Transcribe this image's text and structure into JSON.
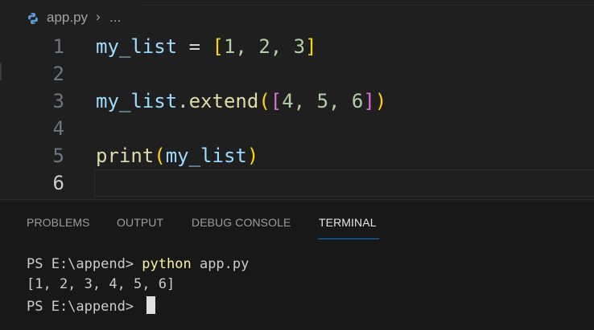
{
  "breadcrumb": {
    "file": "app.py",
    "separator": "›",
    "ellipsis": "..."
  },
  "editor": {
    "lines": [
      {
        "number": "1"
      },
      {
        "number": "2"
      },
      {
        "number": "3"
      },
      {
        "number": "4"
      },
      {
        "number": "5"
      },
      {
        "number": "6"
      }
    ],
    "code": {
      "line1": {
        "var": "my_list",
        "eq": " = ",
        "open": "[",
        "items": "1, 2, 3",
        "close": "]"
      },
      "line3": {
        "var": "my_list",
        "dot": ".",
        "fn": "extend",
        "open_paren": "(",
        "open_br": "[",
        "items": "4, 5, 6",
        "close_br": "]",
        "close_paren": ")"
      },
      "line5": {
        "fn": "print",
        "open_paren": "(",
        "var": "my_list",
        "close_paren": ")"
      }
    }
  },
  "panel": {
    "tabs": [
      "PROBLEMS",
      "OUTPUT",
      "DEBUG CONSOLE",
      "TERMINAL"
    ],
    "active_tab": "TERMINAL"
  },
  "terminal": {
    "prompt1": "PS E:\\append> ",
    "command": "python",
    "args": " app.py",
    "output": "[1, 2, 3, 4, 5, 6]",
    "prompt2": "PS E:\\append> "
  },
  "colors": {
    "background": "#1f1f1f",
    "variable": "#9cdcfe",
    "function": "#dcdcaa",
    "number": "#b5cea8",
    "bracket_level1": "#ffd700",
    "bracket_level2": "#da70d6",
    "terminal_command": "#f9f1a5",
    "active_tab_underline": "#0078d4"
  },
  "icons": {
    "file_type": "python-icon"
  }
}
